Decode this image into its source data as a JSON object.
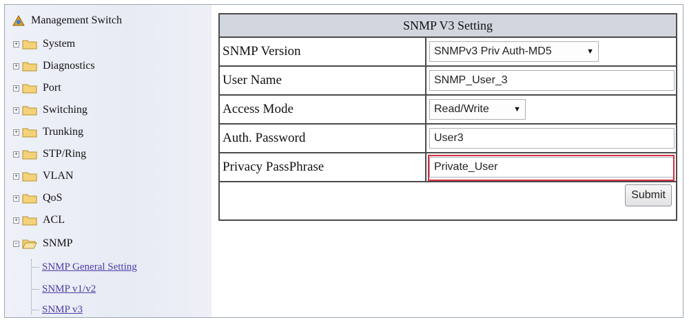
{
  "sidebar": {
    "root_label": "Management Switch",
    "items": [
      {
        "label": "System"
      },
      {
        "label": "Diagnostics"
      },
      {
        "label": "Port"
      },
      {
        "label": "Switching"
      },
      {
        "label": "Trunking"
      },
      {
        "label": "STP/Ring"
      },
      {
        "label": "VLAN"
      },
      {
        "label": "QoS"
      },
      {
        "label": "ACL"
      },
      {
        "label": "SNMP"
      }
    ],
    "snmp_links": [
      {
        "label": "SNMP General Setting"
      },
      {
        "label": "SNMP v1/v2"
      },
      {
        "label": "SNMP v3"
      }
    ]
  },
  "panel": {
    "title": "SNMP V3 Setting",
    "rows": [
      {
        "label": "SNMP Version",
        "value": "SNMPv3 Priv Auth-MD5"
      },
      {
        "label": "User Name",
        "value": "SNMP_User_3"
      },
      {
        "label": "Access Mode",
        "value": "Read/Write"
      },
      {
        "label": "Auth. Password",
        "value": "User3"
      },
      {
        "label": "Privacy PassPhrase",
        "value": "Private_User"
      }
    ],
    "submit_label": "Submit",
    "highlight_color": "#d32f3f"
  },
  "icons": {
    "folder": "folder-icon",
    "expander": "expand-toggle-icon",
    "root": "network-root-icon",
    "dropdown": "dropdown-arrow-icon"
  }
}
